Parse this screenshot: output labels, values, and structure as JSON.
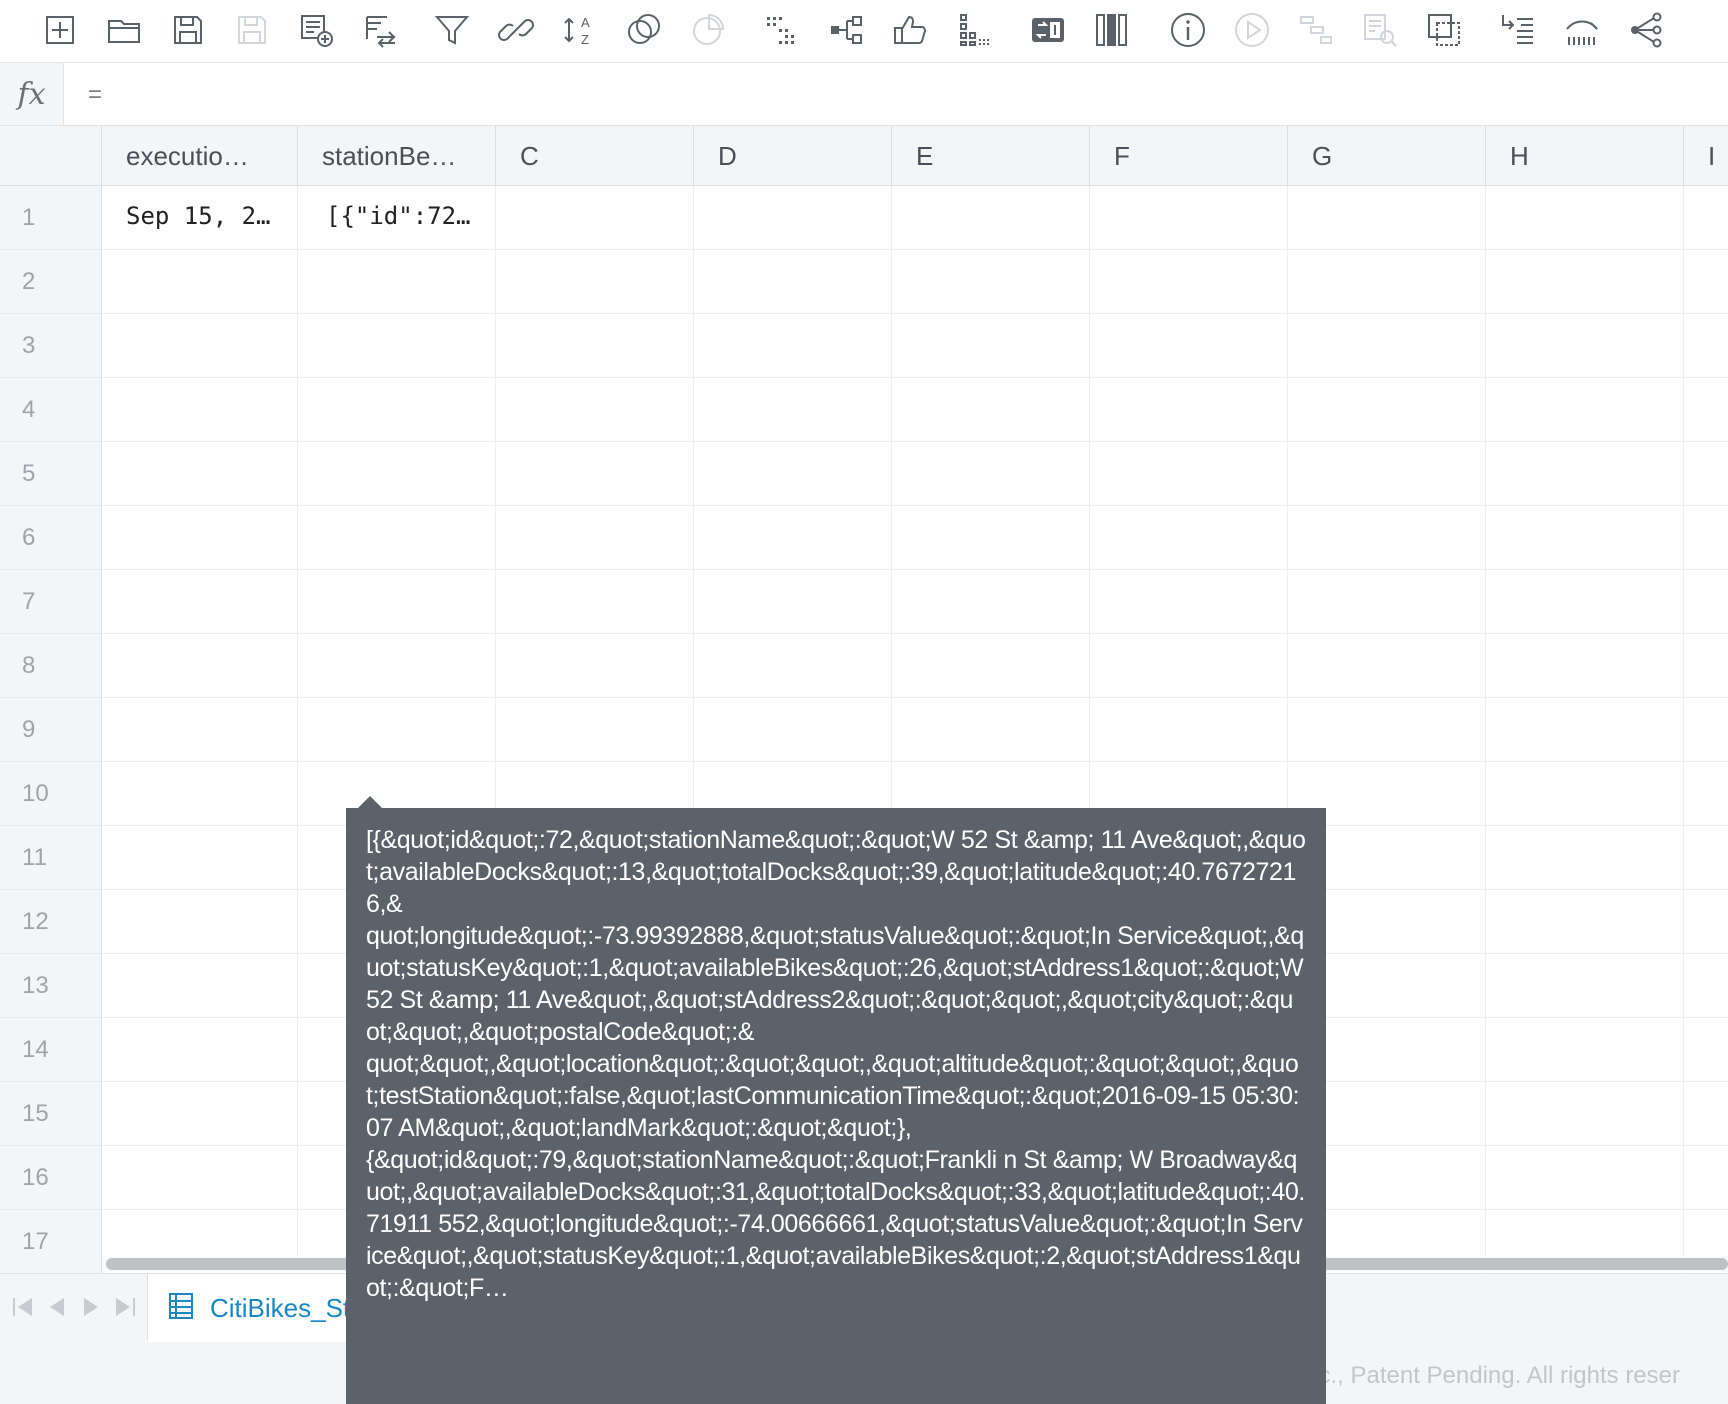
{
  "toolbar": {
    "buttons": [
      {
        "name": "add-sheet-icon",
        "enabled": true
      },
      {
        "name": "open-folder-icon",
        "enabled": true
      },
      {
        "name": "save-icon",
        "enabled": true
      },
      {
        "name": "save-as-icon",
        "enabled": false
      },
      {
        "name": "add-data-icon",
        "enabled": true
      },
      {
        "name": "join-icon",
        "enabled": true
      },
      {
        "name": "filter-icon",
        "enabled": true
      },
      {
        "name": "link-icon",
        "enabled": true
      },
      {
        "name": "sort-az-icon",
        "enabled": true
      },
      {
        "name": "union-icon",
        "enabled": true
      },
      {
        "name": "pie-chart-icon",
        "enabled": false
      },
      {
        "name": "sparse-grid-icon",
        "enabled": true
      },
      {
        "name": "tree-icon",
        "enabled": true
      },
      {
        "name": "thumbs-up-icon",
        "enabled": true
      },
      {
        "name": "grouping-icon",
        "enabled": true
      },
      {
        "name": "swap-icon",
        "enabled": true
      },
      {
        "name": "columns-icon",
        "enabled": true
      },
      {
        "name": "info-icon",
        "enabled": true
      },
      {
        "name": "play-icon",
        "enabled": false
      },
      {
        "name": "lineage-icon",
        "enabled": false
      },
      {
        "name": "search-sheet-icon",
        "enabled": false
      },
      {
        "name": "duplicate-icon",
        "enabled": true
      },
      {
        "name": "indent-list-icon",
        "enabled": true
      },
      {
        "name": "histogram-icon",
        "enabled": true
      },
      {
        "name": "network-icon",
        "enabled": true
      }
    ]
  },
  "formula_bar": {
    "fx_label": "fx",
    "value": "="
  },
  "grid": {
    "columns": [
      "executio…",
      "stationBe…",
      "C",
      "D",
      "E",
      "F",
      "G",
      "H",
      "I"
    ],
    "rows": [
      "1",
      "2",
      "3",
      "4",
      "5",
      "6",
      "7",
      "8",
      "9",
      "10",
      "11",
      "12",
      "13",
      "14",
      "15",
      "16",
      "17"
    ],
    "cells": {
      "r1c1": "Sep 15, 2…",
      "r1c2": "[{\"id\":72…"
    }
  },
  "bottom_bar": {
    "sheet_tab_label": "CitiBikes_Sta",
    "footer": "© 2016 Datameer Inc., Patent Pending. All rights reser"
  },
  "tooltip": {
    "text": "[{&quot;id&quot;:72,&quot;stationName&quot;:&quot;W 52 St &amp; 11 Ave&quot;,&quot;availableDocks&quot;:13,&quot;totalDocks&quot;:39,&quot;latitude&quot;:40.76727216,&\nquot;longitude&quot;:-73.99392888,&quot;statusValue&quot;:&quot;In Service&quot;,&quot;statusKey&quot;:1,&quot;availableBikes&quot;:26,&quot;stAddress1&quot;:&quot;W 52 St &amp; 11 Ave&quot;,&quot;stAddress2&quot;:&quot;&quot;,&quot;city&quot;:&quot;&quot;,&quot;postalCode&quot;:&\nquot;&quot;,&quot;location&quot;:&quot;&quot;,&quot;altitude&quot;:&quot;&quot;,&quot;testStation&quot;:false,&quot;lastCommunicationTime&quot;:&quot;2016-09-15 05:30:07 AM&quot;,&quot;landMark&quot;:&quot;&quot;},\n{&quot;id&quot;:79,&quot;stationName&quot;:&quot;Frankli n St &amp; W Broadway&quot;,&quot;availableDocks&quot;:31,&quot;totalDocks&quot;:33,&quot;latitude&quot;:40.71911 552,&quot;longitude&quot;:-74.00666661,&quot;statusValue&quot;:&quot;In Service&quot;,&quot;statusKey&quot;:1,&quot;availableBikes&quot;:2,&quot;stAddress1&quot;:&quot;F…"
  },
  "colors": {
    "accent": "#1a86c6",
    "tooltip_bg": "#5c6269",
    "header_bg": "#f4f5f6"
  }
}
